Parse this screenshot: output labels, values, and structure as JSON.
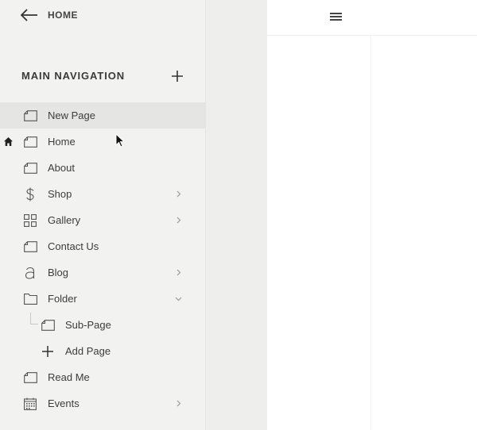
{
  "back": {
    "label": "HOME"
  },
  "section": {
    "title": "MAIN NAVIGATION"
  },
  "nav_items": [
    {
      "label": "New Page",
      "icon": "page-icon",
      "active": true
    },
    {
      "label": "Home",
      "icon": "page-icon",
      "is_homepage": true
    },
    {
      "label": "About",
      "icon": "page-icon"
    },
    {
      "label": "Shop",
      "icon": "dollar-icon",
      "chevron": "right"
    },
    {
      "label": "Gallery",
      "icon": "gallery-grid-icon",
      "chevron": "right"
    },
    {
      "label": "Contact Us",
      "icon": "page-icon"
    },
    {
      "label": "Blog",
      "icon": "blog-icon",
      "chevron": "right"
    },
    {
      "label": "Folder",
      "icon": "folder-icon",
      "chevron": "down"
    },
    {
      "label": "Sub-Page",
      "icon": "page-icon",
      "indent": true
    },
    {
      "label": "Add Page",
      "icon": "plus-icon",
      "indent": true
    },
    {
      "label": "Read Me",
      "icon": "page-icon"
    },
    {
      "label": "Events",
      "icon": "calendar-icon",
      "chevron": "right"
    }
  ],
  "colors": {
    "sidebar_bg": "#f2f2f0",
    "active_row": "#e5e5e3",
    "text": "#3d3d3d"
  }
}
